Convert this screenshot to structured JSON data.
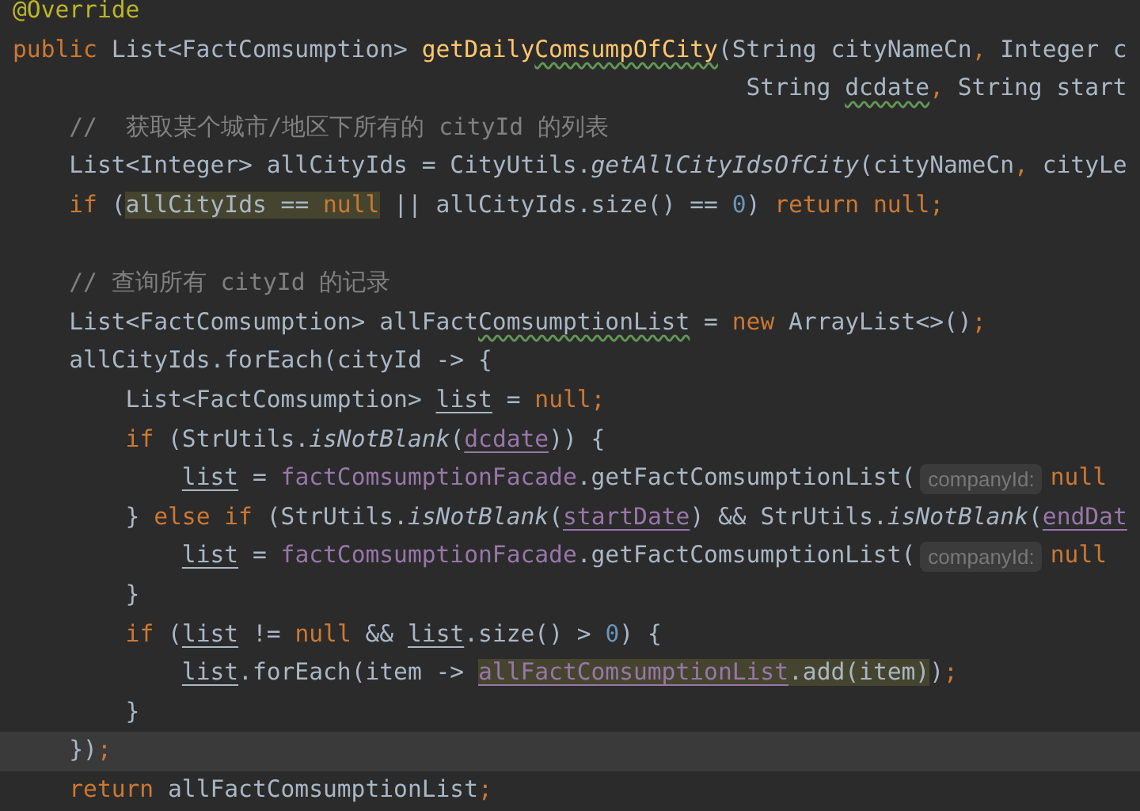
{
  "editor": {
    "lines": [
      {
        "current": false,
        "tokens": [
          {
            "kind": "annotation",
            "text": "@Override"
          }
        ]
      },
      {
        "current": false,
        "tokens": [
          {
            "kind": "keyword",
            "text": "public "
          },
          {
            "kind": "plain",
            "text": "List<FactComsumption> "
          },
          {
            "kind": "declaration",
            "text": "getDaily"
          },
          {
            "kind": "declaration-squiggly",
            "text": "ComsumpOfCity"
          },
          {
            "kind": "plain",
            "text": "(String cityNameCn"
          },
          {
            "kind": "keyword",
            "text": ", "
          },
          {
            "kind": "plain",
            "text": "Integer c"
          }
        ]
      },
      {
        "current": false,
        "tokens": [
          {
            "kind": "plain",
            "text": "                                                    String "
          },
          {
            "kind": "plain-squiggly",
            "text": "dcdate"
          },
          {
            "kind": "keyword",
            "text": ", "
          },
          {
            "kind": "plain",
            "text": "String start"
          }
        ]
      },
      {
        "current": false,
        "tokens": [
          {
            "kind": "comment",
            "text": "    //  获取某个城市/地区下所有的 cityId 的列表"
          }
        ]
      },
      {
        "current": false,
        "tokens": [
          {
            "kind": "plain",
            "text": "    List<Integer> allCityIds = CityUtils."
          },
          {
            "kind": "static",
            "text": "getAllCityIdsOfCity"
          },
          {
            "kind": "plain",
            "text": "(cityNameCn"
          },
          {
            "kind": "keyword",
            "text": ", "
          },
          {
            "kind": "plain",
            "text": "cityLe"
          }
        ]
      },
      {
        "current": false,
        "tokens": [
          {
            "kind": "keyword",
            "text": "    if "
          },
          {
            "kind": "plain",
            "text": "("
          },
          {
            "kind": "plain-highlighted",
            "text": "allCityIds == "
          },
          {
            "kind": "keyword-highlighted",
            "text": "null"
          },
          {
            "kind": "plain",
            "text": " || allCityIds.size() == "
          },
          {
            "kind": "number",
            "text": "0"
          },
          {
            "kind": "plain",
            "text": ") "
          },
          {
            "kind": "keyword",
            "text": "return null;"
          }
        ]
      },
      {
        "current": false
      },
      {
        "current": false,
        "tokens": [
          {
            "kind": "comment",
            "text": "    // 查询所有 cityId 的记录"
          }
        ]
      },
      {
        "current": false,
        "tokens": [
          {
            "kind": "plain",
            "text": "    List<FactComsumption> allFact"
          },
          {
            "kind": "plain-squiggly",
            "text": "ComsumptionList"
          },
          {
            "kind": "plain",
            "text": " = "
          },
          {
            "kind": "keyword",
            "text": "new "
          },
          {
            "kind": "plain",
            "text": "ArrayList<>()"
          },
          {
            "kind": "keyword",
            "text": ";"
          }
        ]
      },
      {
        "current": false,
        "tokens": [
          {
            "kind": "plain",
            "text": "    allCityIds.forEach(cityId -> {"
          }
        ]
      },
      {
        "current": false,
        "tokens": [
          {
            "kind": "plain",
            "text": "        List<FactComsumption> "
          },
          {
            "kind": "plain-underlined",
            "text": "list"
          },
          {
            "kind": "plain",
            "text": " = "
          },
          {
            "kind": "keyword",
            "text": "null;"
          }
        ]
      },
      {
        "current": false,
        "tokens": [
          {
            "kind": "keyword",
            "text": "        if "
          },
          {
            "kind": "plain",
            "text": "(StrUtils."
          },
          {
            "kind": "static",
            "text": "isNotBlank"
          },
          {
            "kind": "plain",
            "text": "("
          },
          {
            "kind": "field-underlined",
            "text": "dcdate"
          },
          {
            "kind": "plain",
            "text": ")) {"
          }
        ]
      },
      {
        "current": false,
        "tokens": [
          {
            "kind": "plain-underlined",
            "text": "            list"
          },
          {
            "kind": "plain",
            "text": " = "
          },
          {
            "kind": "field",
            "text": "factComsumptionFacade"
          },
          {
            "kind": "plain",
            "text": ".getFactComsumptionList("
          },
          {
            "kind": "hint",
            "text": "companyId:"
          },
          {
            "kind": "keyword",
            "text": "null"
          }
        ]
      },
      {
        "current": false,
        "tokens": [
          {
            "kind": "plain",
            "text": "        } "
          },
          {
            "kind": "keyword",
            "text": "else if "
          },
          {
            "kind": "plain",
            "text": "(StrUtils."
          },
          {
            "kind": "static",
            "text": "isNotBlank"
          },
          {
            "kind": "plain",
            "text": "("
          },
          {
            "kind": "field-underlined",
            "text": "startDate"
          },
          {
            "kind": "plain",
            "text": ") && StrUtils."
          },
          {
            "kind": "static",
            "text": "isNotBlank"
          },
          {
            "kind": "plain",
            "text": "("
          },
          {
            "kind": "field-underlined",
            "text": "endDat"
          }
        ]
      },
      {
        "current": false,
        "tokens": [
          {
            "kind": "plain-underlined",
            "text": "            list"
          },
          {
            "kind": "plain",
            "text": " = "
          },
          {
            "kind": "field",
            "text": "factComsumptionFacade"
          },
          {
            "kind": "plain",
            "text": ".getFactComsumptionList("
          },
          {
            "kind": "hint",
            "text": "companyId:"
          },
          {
            "kind": "keyword",
            "text": "null"
          }
        ]
      },
      {
        "current": false,
        "tokens": [
          {
            "kind": "plain",
            "text": "        }"
          }
        ]
      },
      {
        "current": false,
        "tokens": [
          {
            "kind": "keyword",
            "text": "        if "
          },
          {
            "kind": "plain",
            "text": "("
          },
          {
            "kind": "plain-underlined",
            "text": "list"
          },
          {
            "kind": "plain",
            "text": " != "
          },
          {
            "kind": "keyword",
            "text": "null"
          },
          {
            "kind": "plain",
            "text": " && "
          },
          {
            "kind": "plain-underlined",
            "text": "list"
          },
          {
            "kind": "plain",
            "text": ".size() > "
          },
          {
            "kind": "number",
            "text": "0"
          },
          {
            "kind": "plain",
            "text": ") {"
          }
        ]
      },
      {
        "current": false,
        "tokens": [
          {
            "kind": "plain-underlined",
            "text": "            list"
          },
          {
            "kind": "plain",
            "text": ".forEach(item -> "
          },
          {
            "kind": "field-underlined-highlighted",
            "text": "allFactComsumptionList"
          },
          {
            "kind": "plain-highlighted",
            "text": ".add(item)"
          },
          {
            "kind": "plain",
            "text": ")"
          },
          {
            "kind": "keyword",
            "text": ";"
          }
        ]
      },
      {
        "current": false,
        "tokens": [
          {
            "kind": "plain",
            "text": "        }"
          }
        ]
      },
      {
        "current": true,
        "tokens": [
          {
            "kind": "plain",
            "text": "    })"
          },
          {
            "kind": "keyword",
            "text": ";"
          }
        ]
      },
      {
        "current": false,
        "tokens": [
          {
            "kind": "keyword",
            "text": "    return "
          },
          {
            "kind": "plain",
            "text": "allFactComsumptionList"
          },
          {
            "kind": "keyword",
            "text": ";"
          }
        ]
      }
    ]
  }
}
